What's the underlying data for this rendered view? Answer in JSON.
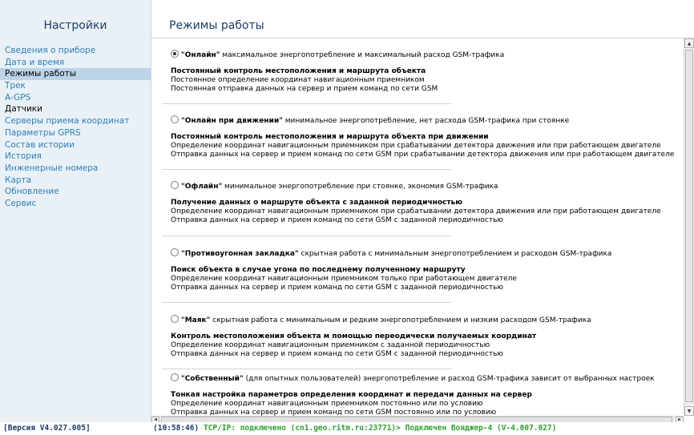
{
  "sidebar": {
    "title": "Настройки",
    "items": [
      {
        "label": "Сведения о приборе"
      },
      {
        "label": "Дата и время"
      },
      {
        "label": "Режимы работы"
      },
      {
        "label": "Трек"
      },
      {
        "label": "A-GPS"
      },
      {
        "label": "Датчики"
      },
      {
        "label": "Серверы приема координат"
      },
      {
        "label": "Параметры GPRS"
      },
      {
        "label": "Состав истории"
      },
      {
        "label": "История"
      },
      {
        "label": "Инженерные номера"
      },
      {
        "label": "Карта"
      },
      {
        "label": "Обновление"
      },
      {
        "label": "Сервис"
      }
    ]
  },
  "header": {
    "title": "Режимы работы"
  },
  "modes": [
    {
      "name": "\"Онлайн\"",
      "desc": "максимальное энергопотребление и максимальный расход GSM-трафика",
      "selected": true,
      "title": "Постоянный контроль местоположения и маршрута объекта",
      "lines": [
        "Постоянное определение координат навигационным приемником",
        "Постоянная отправка данных на сервер и прием команд по сети GSM"
      ]
    },
    {
      "name": "\"Онлайн при движении\"",
      "desc": "минимальное энергопотребление, нет расхода GSM-трафика при стоянке",
      "selected": false,
      "title": "Постоянный контроль местоположения и маршрута объекта при движении",
      "lines": [
        "Определение координат навигационным приемником при срабатывании детектора движения или при работающем двигателе",
        "Отправка данных на сервер и прием команд по сети GSM при срабатывании детектора движения или при работающем двигателе"
      ]
    },
    {
      "name": "\"Офлайн\"",
      "desc": "минимальное энергопотребление при стоянке, экономия GSM-трафика",
      "selected": false,
      "title": "Получение данных о маршруте объекта с заданной периодичностью",
      "lines": [
        "Определение координат навигационным приемником при срабатывании детектора движения или при работающем двигателе",
        "Отправка данных на сервер и прием команд по сети GSM с заданной периодичностью"
      ]
    },
    {
      "name": "\"Противоугонная закладка\"",
      "desc": "скрытная работа с минимальным энергопотреблением и расходом GSM-трафика",
      "selected": false,
      "title": "Поиск объекта в случае угона по последнему полученному маршруту",
      "lines": [
        "Определение координат навигационным приемником только при работающем двигателе",
        "Отправка данных на сервер и прием команд по сети GSM с заданной периодичностью"
      ]
    },
    {
      "name": "\"Маяк\"",
      "desc": "скрытная работа с минимальным и редким энергопотреблением и низким расходом GSM-трафика",
      "selected": false,
      "title": "Контроль местоположения объекта м помощью переодически получаемых координат",
      "lines": [
        "Определение координат навигационным приемником с заданной периодичностью",
        "Отправка данных на сервер и прием команд по сети GSM с заданной периодичностью"
      ]
    },
    {
      "name": "\"Собственный\"",
      "desc": "(для опытных пользователей) энергопотребление и расход GSM-трафика зависит от выбранных настроек",
      "selected": false,
      "title": "Тонкая настройка параметров определения координат и передачи данных на сервер",
      "lines": [
        "Определение координат навигационным приемником постоянно или по условию",
        "Отправка данных на сервер и прием команд по сети GSM постоянно или по условию"
      ]
    }
  ],
  "statusbar": {
    "version": "[Версия V4.027.005]",
    "time": "(10:58:46)",
    "connection": "TCP/IP: подключено (cn1.geo.ritm.ru:23771)>",
    "device": "Подключен Вояджер-4 (V-4.007.027)"
  },
  "colors": {
    "sidebar_bg": "#e9f1f7",
    "active_bg": "#bcd3e8",
    "link": "#2f7fb8",
    "title": "#1d3e66",
    "status_green": "#2e9e2e"
  }
}
